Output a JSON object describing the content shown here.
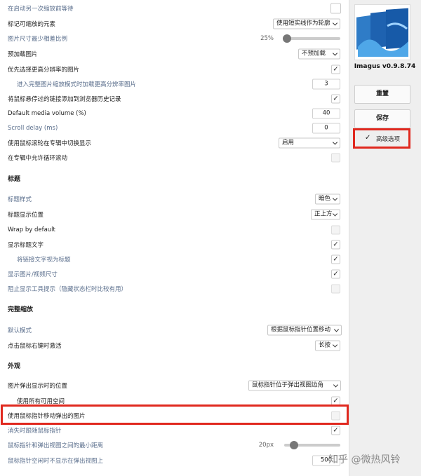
{
  "main": {
    "rows": [
      {
        "label": "在启动另一次缩放前等待",
        "blue": true
      },
      {
        "label": "标记可缩放的元素",
        "select": "使用短实线作为轮廓"
      },
      {
        "label": "图片尺寸最少相差比例",
        "blue": true,
        "slider_value": "25%",
        "slider_fraction": 0.25
      },
      {
        "label": "预加载图片",
        "select": "不预加载"
      },
      {
        "label": "优先选择更高分辨率的图片",
        "checked": true
      },
      {
        "label": "进入完整图片缩放模式时加载更高分辨率图片",
        "blue": true,
        "indent": true,
        "number": "3"
      },
      {
        "label": "将鼠标悬停过的链接添加到浏览器历史记录",
        "checked": true
      },
      {
        "label": "Default media volume (%)",
        "number": "40"
      },
      {
        "label": "Scroll delay (ms)",
        "blue": true,
        "number": "0"
      },
      {
        "label": "使用鼠标滚轮在专辑中切换显示",
        "select": "启用"
      },
      {
        "label": "在专辑中允许循环滚动",
        "checked": false
      }
    ],
    "section_caption": "标题",
    "caption_rows": [
      {
        "label": "标题样式",
        "blue": true,
        "select": "暗色"
      },
      {
        "label": "标题显示位置",
        "select": "正上方"
      },
      {
        "label": "Wrap by default",
        "checked": false
      },
      {
        "label": "显示标题文字",
        "checked": true
      },
      {
        "label": "将链接文字视为标题",
        "blue": true,
        "indent": true,
        "checked": true
      },
      {
        "label": "显示图片/视频尺寸",
        "blue": true,
        "checked": true
      },
      {
        "label": "阻止显示工具提示（隐藏状态栏时比较有用）",
        "blue": true,
        "checked": false
      }
    ],
    "section_zoom": "完整缩放",
    "zoom_rows": [
      {
        "label": "默认模式",
        "blue": true,
        "select": "根据鼠标指针位置移动"
      },
      {
        "label": "点击鼠标右键时激活",
        "select": "长按"
      }
    ],
    "section_appearance": "外观",
    "appearance_rows": [
      {
        "label": "图片弹出显示时的位置",
        "select": "鼠标指针位于弹出视图边角"
      },
      {
        "label": "使用所有可用空间",
        "indent": true,
        "checked": true
      },
      {
        "label": "使用鼠标指针移动弹出的图片",
        "checked": false
      },
      {
        "label": "消失时跟随鼠标指针",
        "blue": true,
        "checked": true
      },
      {
        "label": "鼠标指针和弹出视图之间的最小距离",
        "blue": true,
        "slider_value": "20px",
        "slider_fraction": 0.2
      },
      {
        "label": "鼠标指针空闲时不显示在弹出视图上",
        "blue": true,
        "number": "500"
      }
    ]
  },
  "sidebar": {
    "version": "Imagus v0.9.8.74",
    "reset_label": "重置",
    "save_label": "保存",
    "advanced_label": "高级选项",
    "advanced_checked": true
  },
  "watermark": "知乎 @微热风铃",
  "colors": {
    "highlight": "#e0281e",
    "label_blue": "#5a6e8c"
  }
}
